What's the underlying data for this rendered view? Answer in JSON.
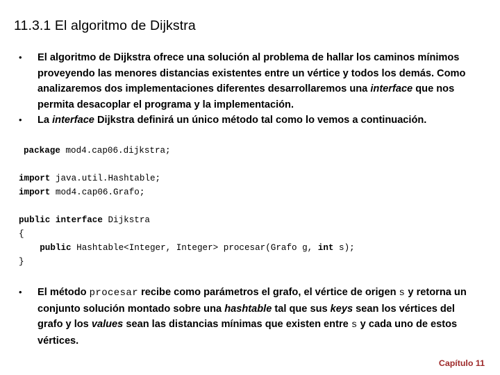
{
  "slide": {
    "title": "11.3.1 El algoritmo de Dijkstra",
    "bullet_marker": "•",
    "bullets_top": [
      {
        "id": "bullet-dijkstra-intro",
        "parts": [
          {
            "text": "El algoritmo de Dijkstra ofrece una solución al problema de hallar los caminos mínimos proveyendo las menores distancias existentes entre un vértice y todos los demás. Como analizaremos dos implementaciones diferentes desarrollaremos una ",
            "style": "normal"
          },
          {
            "text": "interface",
            "style": "italic"
          },
          {
            "text": " que nos permita desacoplar el programa y la implementación.",
            "style": "normal"
          }
        ]
      },
      {
        "id": "bullet-interface-dijkstra",
        "parts": [
          {
            "text": "La ",
            "style": "normal"
          },
          {
            "text": "interface",
            "style": "italic"
          },
          {
            "text": " Dijkstra definirá un único método tal como lo vemos a continuación.",
            "style": "normal"
          }
        ]
      }
    ],
    "code": [
      {
        "indent": "package",
        "tokens": [
          {
            "text": "package",
            "style": "keyword"
          },
          {
            "text": " mod4.cap06.dijkstra;",
            "style": "plain"
          }
        ]
      },
      {
        "indent": "blank",
        "tokens": []
      },
      {
        "indent": "plain",
        "tokens": [
          {
            "text": "import",
            "style": "keyword"
          },
          {
            "text": " java.util.Hashtable;",
            "style": "plain"
          }
        ]
      },
      {
        "indent": "plain",
        "tokens": [
          {
            "text": "import",
            "style": "keyword"
          },
          {
            "text": " mod4.cap06.Grafo;",
            "style": "plain"
          }
        ]
      },
      {
        "indent": "blank",
        "tokens": []
      },
      {
        "indent": "plain",
        "tokens": [
          {
            "text": "public interface",
            "style": "keyword"
          },
          {
            "text": " Dijkstra",
            "style": "plain"
          }
        ]
      },
      {
        "indent": "plain",
        "tokens": [
          {
            "text": "{",
            "style": "plain"
          }
        ]
      },
      {
        "indent": "plain",
        "tokens": [
          {
            "text": "    ",
            "style": "plain"
          },
          {
            "text": "public",
            "style": "keyword"
          },
          {
            "text": " Hashtable<Integer, Integer> procesar(Grafo g, ",
            "style": "plain"
          },
          {
            "text": "int",
            "style": "keyword"
          },
          {
            "text": " s);",
            "style": "plain"
          }
        ]
      },
      {
        "indent": "plain",
        "tokens": [
          {
            "text": "}",
            "style": "plain"
          }
        ]
      }
    ],
    "bullets_bottom": [
      {
        "id": "bullet-procesar-description",
        "parts": [
          {
            "text": "El método ",
            "style": "normal"
          },
          {
            "text": "procesar",
            "style": "mono"
          },
          {
            "text": " recibe como parámetros el grafo, el vértice de origen ",
            "style": "normal"
          },
          {
            "text": "s",
            "style": "mono"
          },
          {
            "text": " y retorna un conjunto solución montado sobre una ",
            "style": "normal"
          },
          {
            "text": "hashtable",
            "style": "italic"
          },
          {
            "text": " tal que sus ",
            "style": "normal"
          },
          {
            "text": "keys",
            "style": "italic"
          },
          {
            "text": " sean los vértices del grafo y los ",
            "style": "normal"
          },
          {
            "text": "values",
            "style": "italic"
          },
          {
            "text": " sean las distancias mínimas que existen entre ",
            "style": "normal"
          },
          {
            "text": "s",
            "style": "mono"
          },
          {
            "text": " y cada uno de estos vértices.",
            "style": "normal"
          }
        ]
      }
    ],
    "footer": {
      "chapter_label": "Capítulo 11",
      "chapter_color": "#9e2a2a"
    }
  }
}
